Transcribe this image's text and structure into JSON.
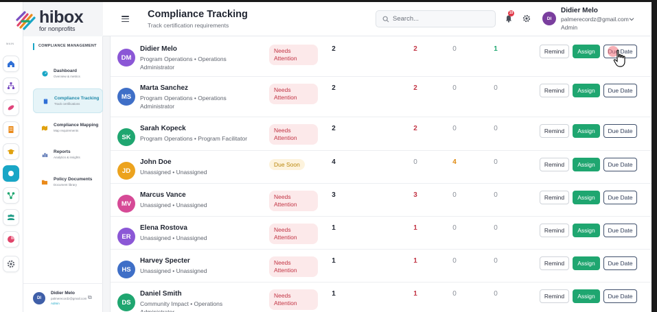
{
  "logo": {
    "main": "hibox",
    "sub": "for nonprofits"
  },
  "rail": {
    "label": "MAIN"
  },
  "subnav": {
    "heading": "COMPLIANCE MANAGEMENT",
    "items": [
      {
        "title": "Dashboard",
        "sub": "Overview & metrics"
      },
      {
        "title": "Compliance Tracking",
        "sub": "Track certifications"
      },
      {
        "title": "Compliance Mapping",
        "sub": "Map requirements"
      },
      {
        "title": "Reports",
        "sub": "Analytics & insights"
      },
      {
        "title": "Policy Documents",
        "sub": "Document library"
      }
    ],
    "user": {
      "initials": "DI",
      "name": "Didier Melo",
      "email": "palmerecordz@gmail.com",
      "role": "Admin"
    }
  },
  "header": {
    "title": "Compliance Tracking",
    "subtitle": "Track certification requirements",
    "search_placeholder": "Search...",
    "notif_count": "10",
    "user": {
      "initials": "DI",
      "name": "Didier Melo",
      "email": "palmerecordz@gmail.com",
      "role": "Admin"
    }
  },
  "colors": {
    "accent": "#19a6c6",
    "assign": "#1fa670",
    "attention": "#c23444",
    "soon": "#b9860b"
  },
  "actions": {
    "remind": "Remind",
    "assign": "Assign",
    "due": "Due Date"
  },
  "rows": [
    {
      "initials": "DM",
      "color": "#8b57d6",
      "name": "Didier Melo",
      "desc": "Program Operations • Operations Administrator",
      "status": "Needs Attention",
      "statusType": "attn",
      "n1": "2",
      "n2": "2",
      "n3": "0",
      "n4": "1",
      "n2c": "#c23444",
      "n3c": "#8a8f98",
      "n4c": "#1fa670"
    },
    {
      "initials": "MS",
      "color": "#3f6fc7",
      "name": "Marta Sanchez",
      "desc": "Program Operations • Operations Administrator",
      "status": "Needs Attention",
      "statusType": "attn",
      "n1": "2",
      "n2": "2",
      "n3": "0",
      "n4": "0",
      "n2c": "#c23444",
      "n3c": "#8a8f98",
      "n4c": "#8a8f98"
    },
    {
      "initials": "SK",
      "color": "#1fa670",
      "name": "Sarah Kopeck",
      "desc": "Program Operations • Program Facilitator",
      "status": "Needs Attention",
      "statusType": "attn",
      "n1": "2",
      "n2": "2",
      "n3": "0",
      "n4": "0",
      "n2c": "#c23444",
      "n3c": "#8a8f98",
      "n4c": "#8a8f98"
    },
    {
      "initials": "JD",
      "color": "#eca31e",
      "name": "John Doe",
      "desc": "Unassigned • Unassigned",
      "status": "Due Soon",
      "statusType": "soon",
      "n1": "4",
      "n2": "0",
      "n3": "4",
      "n4": "0",
      "n2c": "#8a8f98",
      "n3c": "#e08a10",
      "n4c": "#8a8f98"
    },
    {
      "initials": "MV",
      "color": "#d64a96",
      "name": "Marcus Vance",
      "desc": "Unassigned • Unassigned",
      "status": "Needs Attention",
      "statusType": "attn",
      "n1": "3",
      "n2": "3",
      "n3": "0",
      "n4": "0",
      "n2c": "#c23444",
      "n3c": "#8a8f98",
      "n4c": "#8a8f98"
    },
    {
      "initials": "ER",
      "color": "#8b57d6",
      "name": "Elena Rostova",
      "desc": "Unassigned • Unassigned",
      "status": "Needs Attention",
      "statusType": "attn",
      "n1": "1",
      "n2": "1",
      "n3": "0",
      "n4": "0",
      "n2c": "#c23444",
      "n3c": "#8a8f98",
      "n4c": "#8a8f98"
    },
    {
      "initials": "HS",
      "color": "#3f6fc7",
      "name": "Harvey Specter",
      "desc": "Unassigned • Unassigned",
      "status": "Needs Attention",
      "statusType": "attn",
      "n1": "1",
      "n2": "1",
      "n3": "0",
      "n4": "0",
      "n2c": "#c23444",
      "n3c": "#8a8f98",
      "n4c": "#8a8f98"
    },
    {
      "initials": "DS",
      "color": "#1fa670",
      "name": "Daniel Smith",
      "desc": "Community Impact • Operations Administrator",
      "status": "Needs Attention",
      "statusType": "attn",
      "n1": "1",
      "n2": "1",
      "n3": "0",
      "n4": "0",
      "n2c": "#c23444",
      "n3c": "#8a8f98",
      "n4c": "#8a8f98"
    }
  ]
}
